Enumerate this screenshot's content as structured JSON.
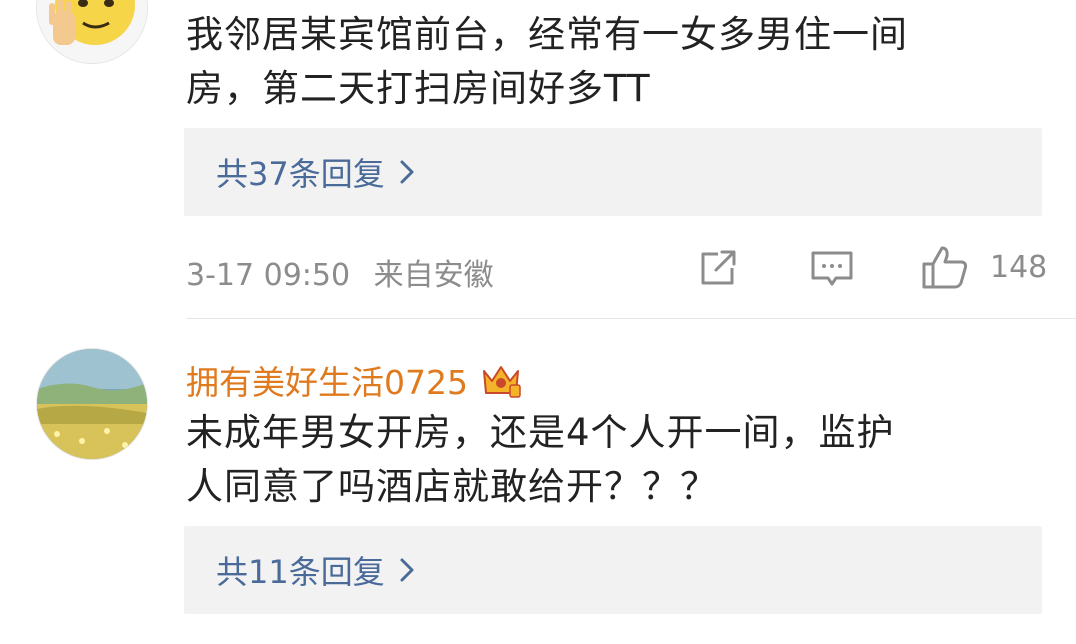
{
  "comments": [
    {
      "text_line1": "我邻居某宾馆前台，经常有一女多男住一间",
      "text_line2": "房，第二天打扫房间好多TT",
      "reply_label": "共37条回复",
      "date": "3-17 09:50",
      "location": "来自安徽",
      "likes": "148"
    },
    {
      "username": "拥有美好生活0725",
      "text_line1": "未成年男女开房，还是4个人开一间，监护",
      "text_line2": "人同意了吗酒店就敢给开？？？",
      "reply_label": "共11条回复"
    }
  ],
  "colors": {
    "username": "#e07a1f",
    "reply_link": "#4a6b9a",
    "meta_text": "#8c8c8c",
    "reply_bg": "#f2f2f2"
  },
  "icons": [
    "emoji-avatar-icon",
    "chevron-right-icon",
    "share-icon",
    "comment-icon",
    "like-icon",
    "crown-badge-icon"
  ]
}
